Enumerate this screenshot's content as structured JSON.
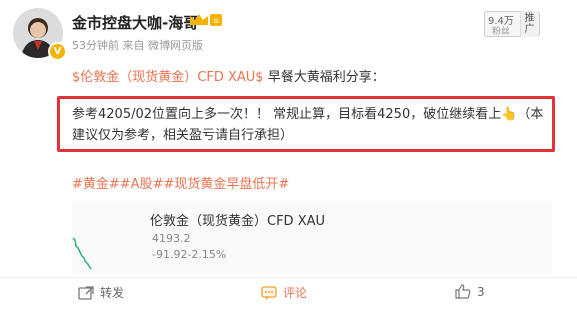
{
  "header": {
    "user_name": "金市控盘大咖-海哥",
    "meta": "53分钟前  来自 微博网页版",
    "fans_count": "9.4万",
    "fans_label": "粉丝",
    "push_label": "推广"
  },
  "post": {
    "topic": "$伦敦金（现货黄金）CFD XAU$",
    "topic_tail": " 早餐大黄福利分享：",
    "quote": "参考4205/02位置向上多一次！！ 常规止算，目标看4250，破位继续看上👆（本建议仅为参考，相关盈亏请自行承担）",
    "hashtags": "#黄金##A股##现货黄金早盘低开#"
  },
  "card": {
    "title": "伦敦金（现货黄金）CFD XAU",
    "price": "4193.2",
    "change": "-91.92-2.15%"
  },
  "actions": {
    "repost_label": "转发",
    "comment_label": "评论",
    "like_count": "3"
  },
  "colors": {
    "accent": "#eb7350",
    "highlight_border": "#e2333b",
    "spark_line": "#2bb673"
  }
}
